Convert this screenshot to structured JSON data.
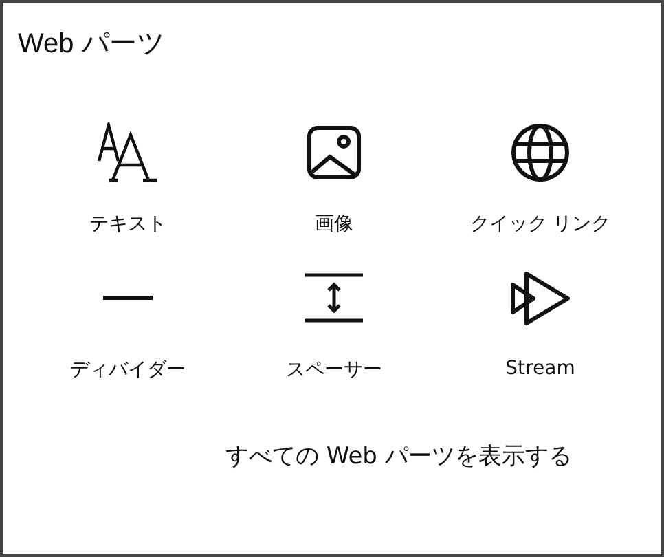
{
  "panel": {
    "title": "Web パーツ",
    "items": [
      {
        "kind": "text",
        "label": "テキスト"
      },
      {
        "kind": "image",
        "label": "画像"
      },
      {
        "kind": "quicklinks",
        "label": "クイック リンク"
      },
      {
        "kind": "divider",
        "label": "ディバイダー"
      },
      {
        "kind": "spacer",
        "label": "スペーサー"
      },
      {
        "kind": "stream",
        "label": "Stream"
      }
    ],
    "show_all": "すべての Web パーツを表示する"
  }
}
